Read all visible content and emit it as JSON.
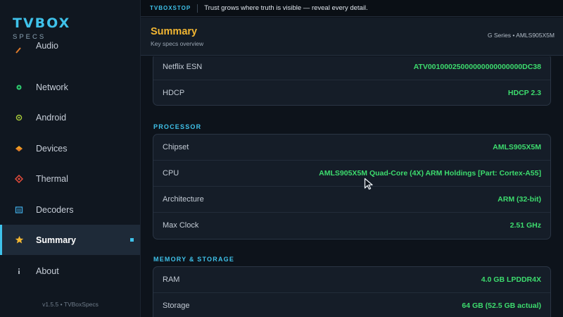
{
  "sidebar": {
    "brand_title": "TVBOX",
    "brand_subtitle": "SPECS",
    "items": [
      {
        "label": "Audio",
        "icon": "speaker-icon",
        "active": false
      },
      {
        "label": "Network",
        "icon": "network-dot-icon",
        "active": false
      },
      {
        "label": "Android",
        "icon": "android-icon",
        "active": false
      },
      {
        "label": "Devices",
        "icon": "devices-icon",
        "active": false
      },
      {
        "label": "Thermal",
        "icon": "thermal-icon",
        "active": false
      },
      {
        "label": "Decoders",
        "icon": "decoders-icon",
        "active": false
      },
      {
        "label": "Summary",
        "icon": "star-icon",
        "active": true
      },
      {
        "label": "About",
        "icon": "info-icon",
        "active": false
      }
    ],
    "version": "v1.5.5  •  TVBoxSpecs"
  },
  "banner": {
    "tag": "TVBOXSTOP",
    "text": "Trust grows where truth is visible — reveal every detail."
  },
  "header": {
    "title": "Summary",
    "subtitle": "Key specs overview",
    "breadcrumb": "G Series  •  AMLS905X5M"
  },
  "sections": {
    "top_card": {
      "rows": [
        {
          "label": "Netflix ESN",
          "value": "ATV00100025000000000000000DC38"
        },
        {
          "label": "HDCP",
          "value": "HDCP 2.3"
        }
      ]
    },
    "processor": {
      "title": "PROCESSOR",
      "rows": [
        {
          "label": "Chipset",
          "value": "AMLS905X5M"
        },
        {
          "label": "CPU",
          "value": "AMLS905X5M  Quad-Core (4X)  ARM Holdings  [Part: Cortex-A55]"
        },
        {
          "label": "Architecture",
          "value": "ARM (32-bit)"
        },
        {
          "label": "Max Clock",
          "value": "2.51 GHz"
        }
      ]
    },
    "memory": {
      "title": "MEMORY & STORAGE",
      "rows": [
        {
          "label": "RAM",
          "value": "4.0 GB LPDDR4X"
        },
        {
          "label": "Storage",
          "value": "64 GB  (52.5 GB actual)"
        }
      ]
    }
  },
  "colors": {
    "accent": "#3fc2ea",
    "title": "#f2b632",
    "value": "#3ddc6e",
    "background": "#0d131b"
  }
}
